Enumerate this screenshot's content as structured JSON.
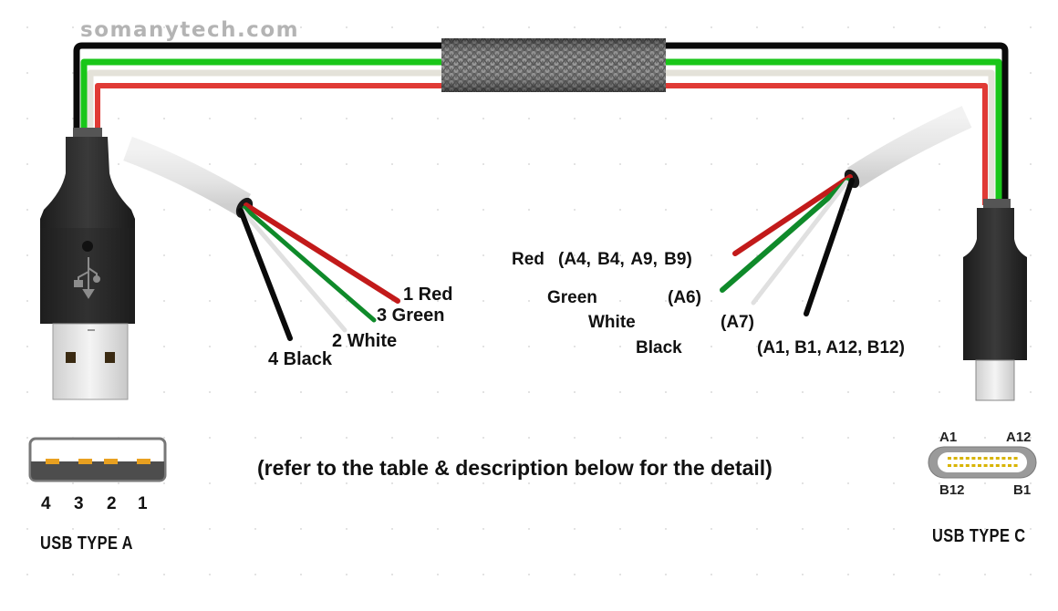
{
  "watermark": "somanytech.com",
  "colors": {
    "red": "#e03a35",
    "green": "#19c619",
    "white_wire": "#e4e2d9",
    "black": "#0a0a0a",
    "dark_red_wire": "#c21a1a",
    "dark_green_wire": "#0f8a2a",
    "connector_pin": "#e8a020",
    "type_c_pin": "#d8b400"
  },
  "usb_a_wires": [
    {
      "number": "1",
      "color": "Red",
      "label": "1 Red"
    },
    {
      "number": "3",
      "color": "Green",
      "label": "3 Green"
    },
    {
      "number": "2",
      "color": "White",
      "label": "2 White"
    },
    {
      "number": "4",
      "color": "Black",
      "label": "4 Black"
    }
  ],
  "usb_c_wires": [
    {
      "color": "Red",
      "pins": "(A4,  B4,  A9,  B9)"
    },
    {
      "color": "Green",
      "pins": "(A6)"
    },
    {
      "color": "White",
      "pins": "(A7)"
    },
    {
      "color": "Black",
      "pins": "(A1, B1, A12, B12)"
    }
  ],
  "note": "(refer to the table & description below for the detail)",
  "usb_a": {
    "title": "USB TYPE A",
    "pin_numbers": [
      "4",
      "3",
      "2",
      "1"
    ]
  },
  "usb_c": {
    "title": "USB TYPE C",
    "pin_labels": {
      "top_left": "A1",
      "top_right": "A12",
      "bottom_left": "B12",
      "bottom_right": "B1"
    },
    "pins_per_row": 12
  }
}
